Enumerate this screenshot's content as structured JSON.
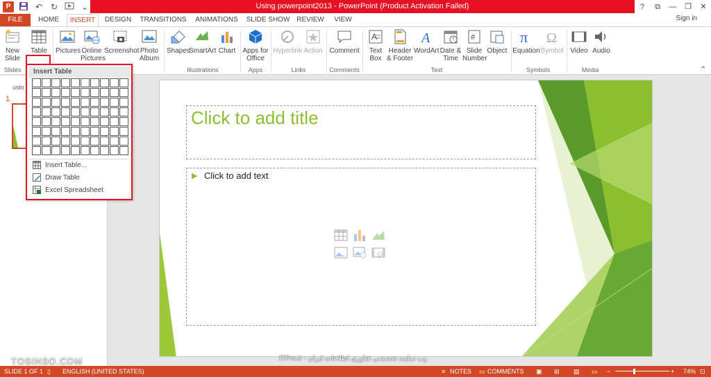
{
  "window": {
    "title": "Using powerpoint2013 - PowerPoint (Product Activation Failed)",
    "controls": [
      "?",
      "⧉",
      "—",
      "❐",
      "✕"
    ]
  },
  "qat": {
    "app_icon": "P"
  },
  "tabs": [
    "FILE",
    "HOME",
    "INSERT",
    "DESIGN",
    "TRANSITIONS",
    "ANIMATIONS",
    "SLIDE SHOW",
    "REVIEW",
    "VIEW"
  ],
  "signin": "Sign in",
  "ribbon": {
    "buttons": {
      "new_slide": "New Slide",
      "table": "Table",
      "pictures": "Pictures",
      "online_pictures": "Online Pictures",
      "screenshot": "Screenshot",
      "photo_album": "Photo Album",
      "shapes": "Shapes",
      "smartart": "SmartArt",
      "chart": "Chart",
      "apps_for_office": "Apps for Office",
      "hyperlink": "Hyperlink",
      "action": "Action",
      "comment": "Comment",
      "text_box": "Text Box",
      "header_footer": "Header & Footer",
      "wordart": "WordArt",
      "date_time": "Date & Time",
      "slide_number": "Slide Number",
      "object": "Object",
      "equation": "Equation",
      "symbol": "Symbol",
      "video": "Video",
      "audio": "Audio"
    },
    "groups": {
      "slides": "Slides",
      "illustrations": "Illustrations",
      "apps": "Apps",
      "links": "Links",
      "comments": "Comments",
      "text": "Text",
      "symbols": "Symbols",
      "media": "Media"
    }
  },
  "insert_table_menu": {
    "header": "Insert Table",
    "rows": 8,
    "cols": 10,
    "items": [
      "Insert Table...",
      "Draw Table",
      "Excel Spreadsheet"
    ]
  },
  "thumbnail_pane": {
    "title": "usin",
    "slide_number": "1"
  },
  "slide": {
    "title_placeholder": "Click to add title",
    "body_placeholder": "Click to add text",
    "bullet": "▶"
  },
  "statusbar": {
    "slide_info": "SLIDE 1 OF 1",
    "language": "ENGLISH (UNITED STATES)",
    "notes": "NOTES",
    "comments": "COMMENTS",
    "zoom": "74%"
  },
  "watermark": {
    "left": "TOSINSO.COM",
    "center": "ITPro.ir - وب سایت تخصصی فناوری اطلاعات ایران"
  },
  "colors": {
    "accent": "#d24726",
    "title_bar_red": "#e81123",
    "slide_green": "#8cbf30"
  }
}
